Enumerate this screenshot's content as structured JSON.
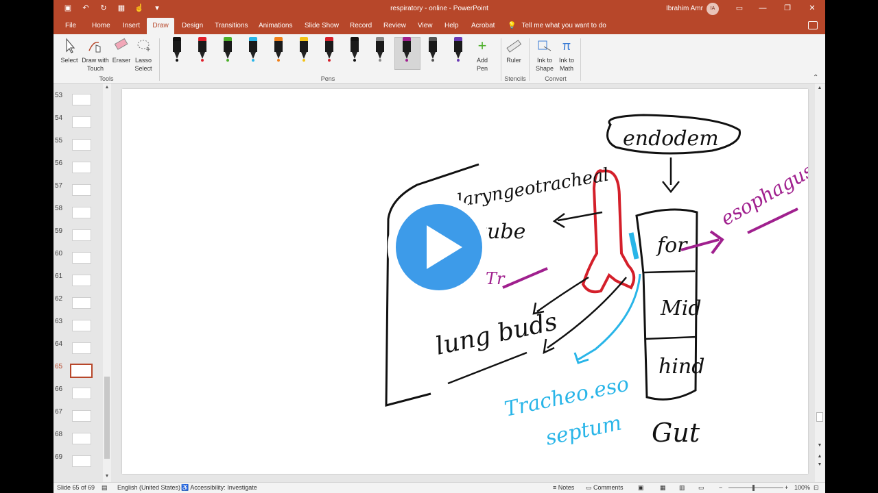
{
  "titlebar": {
    "document_title": "respiratory - online  -  PowerPoint",
    "user_name": "Ibrahim Amr",
    "user_initials": "IA"
  },
  "tabs": [
    "File",
    "Home",
    "Insert",
    "Draw",
    "Design",
    "Transitions",
    "Animations",
    "Slide Show",
    "Record",
    "Review",
    "View",
    "Help",
    "Acrobat"
  ],
  "active_tab": "Draw",
  "tell_me": "Tell me what you want to do",
  "ribbon": {
    "tools": {
      "select": "Select",
      "draw_with_touch_1": "Draw with",
      "draw_with_touch_2": "Touch",
      "eraser": "Eraser",
      "lasso_1": "Lasso",
      "lasso_2": "Select",
      "label": "Tools"
    },
    "pens": {
      "label": "Pens",
      "colors": [
        "#111111",
        "#e0202c",
        "#4caf2a",
        "#29b5e8",
        "#f07f1a",
        "#f2c318",
        "#d41f2a",
        "#111111",
        "#8a8a8a",
        "#a0208e",
        "#555555",
        "#6a3ab5"
      ],
      "add_pen_1": "Add",
      "add_pen_2": "Pen"
    },
    "stencils": {
      "ruler": "Ruler",
      "label": "Stencils"
    },
    "convert": {
      "ink_to_shape_1": "Ink to",
      "ink_to_shape_2": "Shape",
      "ink_to_math_1": "Ink to",
      "ink_to_math_2": "Math",
      "label": "Convert"
    }
  },
  "thumbnails": [
    "53",
    "54",
    "55",
    "56",
    "57",
    "58",
    "59",
    "60",
    "61",
    "62",
    "63",
    "64",
    "65",
    "66",
    "67",
    "68",
    "69"
  ],
  "active_slide": "65",
  "slide": {
    "endoderm": "endodem",
    "laryngo": "laryngeotracheal",
    "tube": "tube",
    "tr": "Tr",
    "lung_buds": "lung buds",
    "fore": "for",
    "mid": "Mid",
    "hind": "hind",
    "gut": "Gut",
    "esophagus": "esophagus",
    "tracheo_1": "Tracheo.eso",
    "tracheo_2": "septum"
  },
  "status": {
    "slide_of": "Slide 65 of 69",
    "language": "English (United States)",
    "accessibility": "Accessibility: Investigate",
    "notes": "Notes",
    "comments": "Comments",
    "zoom": "100%"
  }
}
